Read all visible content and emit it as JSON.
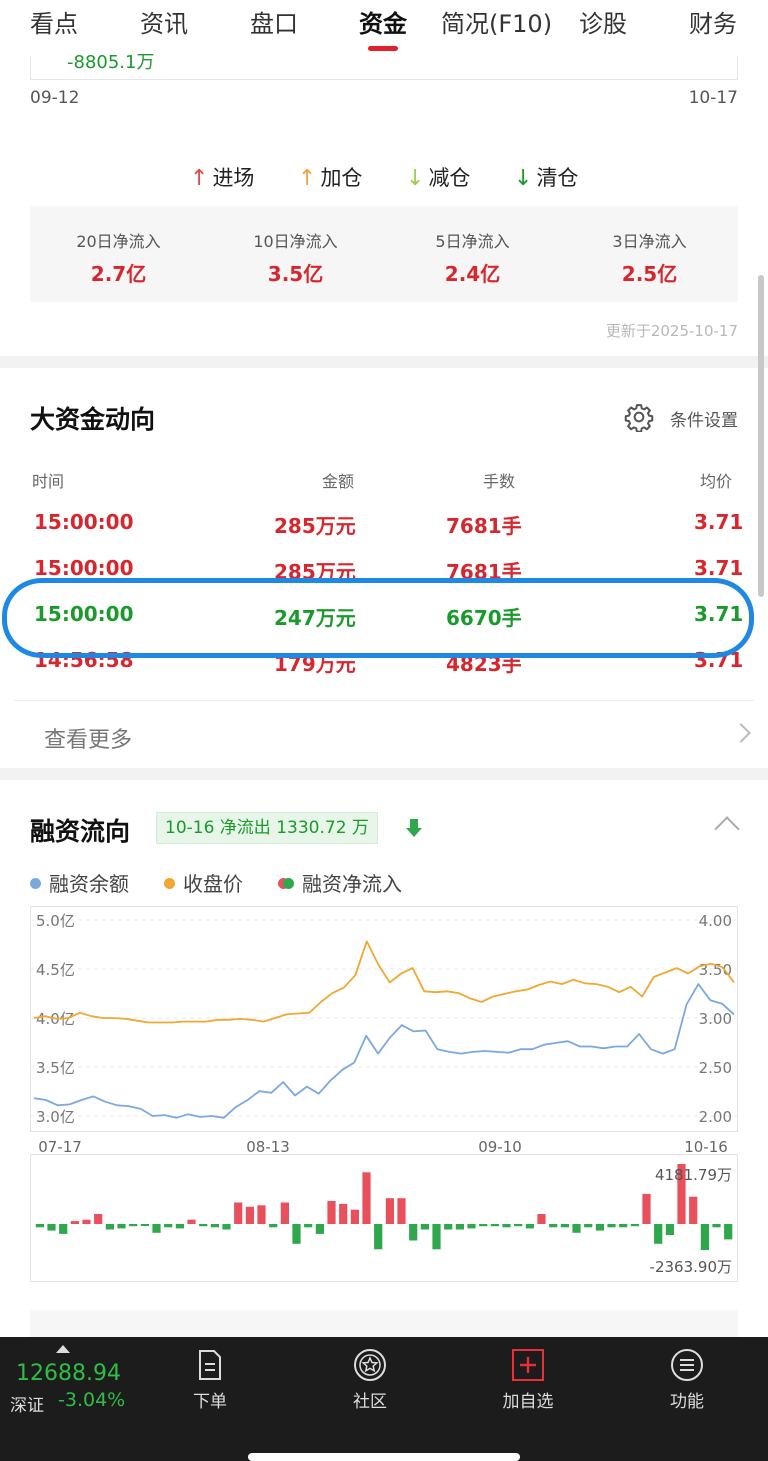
{
  "tabs": [
    {
      "label": "看点",
      "active": false
    },
    {
      "label": "资讯",
      "active": false
    },
    {
      "label": "盘口",
      "active": false
    },
    {
      "label": "资金",
      "active": true
    },
    {
      "label": "简况(F10)",
      "active": false
    },
    {
      "label": "诊股",
      "active": false
    },
    {
      "label": "财务",
      "active": false
    }
  ],
  "prev_chart": {
    "value_label": "-8805.1万",
    "start_date": "09-12",
    "end_date": "10-17"
  },
  "action_legend": [
    {
      "label": "进场",
      "color": "#e8454b",
      "arrow": "↑"
    },
    {
      "label": "加仓",
      "color": "#f5a04a",
      "arrow": "↑"
    },
    {
      "label": "减仓",
      "color": "#9ccf4a",
      "arrow": "↓"
    },
    {
      "label": "清仓",
      "color": "#1a9a2c",
      "arrow": "↓"
    }
  ],
  "net_inflow": [
    {
      "title": "20日净流入",
      "value": "2.7亿"
    },
    {
      "title": "10日净流入",
      "value": "3.5亿"
    },
    {
      "title": "5日净流入",
      "value": "2.4亿"
    },
    {
      "title": "3日净流入",
      "value": "2.5亿"
    }
  ],
  "update_text": "更新于2025-10-17",
  "big_capital": {
    "title": "大资金动向",
    "settings_label": "条件设置",
    "headers": [
      "时间",
      "金额",
      "手数",
      "均价"
    ],
    "rows": [
      {
        "time": "15:00:00",
        "amount": "285万元",
        "lots": "7681手",
        "price": "3.71",
        "color": "red"
      },
      {
        "time": "15:00:00",
        "amount": "285万元",
        "lots": "7681手",
        "price": "3.71",
        "color": "red"
      },
      {
        "time": "15:00:00",
        "amount": "247万元",
        "lots": "6670手",
        "price": "3.71",
        "color": "green"
      },
      {
        "time": "14:56:58",
        "amount": "179万元",
        "lots": "4823手",
        "price": "3.71",
        "color": "red"
      }
    ],
    "more_label": "查看更多"
  },
  "margin": {
    "title": "融资流向",
    "tag": "10-16 净流出 1330.72 万",
    "legend": [
      {
        "label": "融资余额",
        "color": "#7aa9e0"
      },
      {
        "label": "收盘价",
        "color": "#f0a830"
      },
      {
        "label": "融资净流入",
        "colors": [
          "#e8505b",
          "#2ea84a"
        ]
      }
    ]
  },
  "chart_data": {
    "type": "line",
    "left_axis_ticks": [
      "5.0亿",
      "4.5亿",
      "4.0亿",
      "3.5亿",
      "3.0亿"
    ],
    "right_axis_ticks": [
      "4.00",
      "3.50",
      "3.00",
      "2.50",
      "2.00"
    ],
    "x_ticks": [
      "07-17",
      "08-13",
      "09-10",
      "10-16"
    ],
    "bar_max_label": "4181.79万",
    "bar_min_label": "-2363.90万",
    "series": [
      {
        "name": "融资余额",
        "color": "#7aa9e0",
        "axis": "left",
        "ylim": [
          2.9,
          5.1
        ],
        "values": [
          3.1,
          3.08,
          3.02,
          3.03,
          3.08,
          3.12,
          3.06,
          3.02,
          3.01,
          2.98,
          2.9,
          2.91,
          2.88,
          2.92,
          2.89,
          2.9,
          2.88,
          3.0,
          3.08,
          3.18,
          3.16,
          3.28,
          3.13,
          3.23,
          3.15,
          3.3,
          3.42,
          3.5,
          3.8,
          3.6,
          3.78,
          3.92,
          3.85,
          3.86,
          3.65,
          3.62,
          3.6,
          3.62,
          3.63,
          3.62,
          3.61,
          3.65,
          3.65,
          3.7,
          3.72,
          3.74,
          3.68,
          3.68,
          3.66,
          3.68,
          3.68,
          3.82,
          3.65,
          3.6,
          3.65,
          4.15,
          4.38,
          4.2,
          4.16,
          4.04
        ]
      },
      {
        "name": "收盘价",
        "color": "#f0a830",
        "axis": "right",
        "ylim": [
          1.9,
          4.1
        ],
        "values": [
          3.0,
          3.02,
          2.99,
          3.0,
          3.06,
          3.02,
          3.0,
          3.0,
          2.99,
          2.97,
          2.95,
          2.95,
          2.95,
          2.96,
          2.96,
          2.96,
          2.98,
          2.98,
          2.99,
          2.98,
          2.96,
          3.0,
          3.04,
          3.05,
          3.06,
          3.18,
          3.28,
          3.34,
          3.48,
          3.86,
          3.6,
          3.4,
          3.5,
          3.56,
          3.3,
          3.29,
          3.3,
          3.28,
          3.22,
          3.18,
          3.24,
          3.27,
          3.3,
          3.32,
          3.37,
          3.41,
          3.38,
          3.43,
          3.39,
          3.38,
          3.35,
          3.29,
          3.35,
          3.24,
          3.46,
          3.51,
          3.56,
          3.5,
          3.58,
          3.61,
          3.57,
          3.4
        ]
      },
      {
        "name": "融资净流入",
        "type": "bar",
        "unit": "万",
        "values": [
          -300,
          -600,
          -900,
          200,
          300,
          700,
          -500,
          -400,
          -200,
          -100,
          -800,
          -300,
          -400,
          300,
          -200,
          -300,
          -500,
          1500,
          1200,
          1300,
          -300,
          1500,
          -1800,
          -300,
          -900,
          1600,
          1400,
          1000,
          3600,
          -2300,
          1800,
          1800,
          -1500,
          -500,
          -2300,
          -500,
          -500,
          -400,
          -200,
          -200,
          -300,
          -200,
          -400,
          700,
          -300,
          -300,
          -800,
          -300,
          -600,
          -300,
          -300,
          -200,
          2100,
          -1800,
          -1000,
          4181.79,
          1900,
          -2363.9,
          -300,
          -1400
        ]
      }
    ]
  },
  "bottom_nav": {
    "index_value": "12688.94",
    "index_name": "深证",
    "index_pct": "-3.04%",
    "items": [
      {
        "label": "下单",
        "icon": "order-icon"
      },
      {
        "label": "社区",
        "icon": "community-icon"
      },
      {
        "label": "加自选",
        "icon": "add-watchlist-icon"
      },
      {
        "label": "功能",
        "icon": "menu-icon"
      }
    ]
  }
}
